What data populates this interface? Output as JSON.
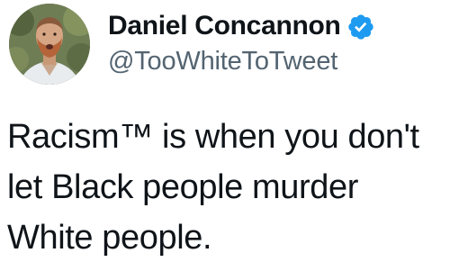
{
  "author": {
    "display_name": "Daniel Concannon",
    "handle": "@TooWhiteToTweet",
    "verified": true,
    "verified_icon": "verified-badge-icon",
    "verified_color": "#1d9bf0"
  },
  "tweet": {
    "lines": [
      "Racism™ is when you don't",
      "let Black people murder",
      "White people."
    ]
  },
  "colors": {
    "text_primary": "#0f1419",
    "text_secondary": "#536471",
    "background": "#ffffff"
  }
}
